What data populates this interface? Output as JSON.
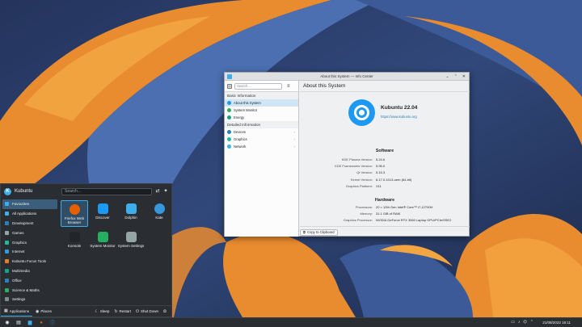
{
  "window": {
    "title": "About this System — Info Center",
    "search_placeholder": "Search...",
    "groups": [
      {
        "label": "Basic Information",
        "items": [
          {
            "label": "About this System",
            "selected": true,
            "color": "#1d99f3"
          },
          {
            "label": "System Monitor",
            "selected": false,
            "color": "#27ae60"
          },
          {
            "label": "Energy",
            "selected": false,
            "color": "#16a085"
          }
        ]
      },
      {
        "label": "Detailed Information",
        "items": [
          {
            "label": "Devices",
            "selected": false,
            "color": "#2980b9"
          },
          {
            "label": "Graphics",
            "selected": false,
            "color": "#1abc9c"
          },
          {
            "label": "Network",
            "selected": false,
            "color": "#3daee9"
          }
        ]
      }
    ],
    "main_title": "About this System",
    "os_name": "Kubuntu 22.04",
    "os_url": "https://www.kubuntu.org",
    "software_heading": "Software",
    "software": [
      {
        "k": "KDE Plasma Version:",
        "v": "5.24.6"
      },
      {
        "k": "KDE Frameworks Version:",
        "v": "5.95.0"
      },
      {
        "k": "Qt Version:",
        "v": "5.15.3"
      },
      {
        "k": "Kernel Version:",
        "v": "6.17.0-1013-oem (64-bit)"
      },
      {
        "k": "Graphics Platform:",
        "v": "X11"
      }
    ],
    "hardware_heading": "Hardware",
    "hardware": [
      {
        "k": "Processors:",
        "v": "20 × 12th Gen Intel® Core™ i7-12700H"
      },
      {
        "k": "Memory:",
        "v": "31.1 GiB of RAM"
      },
      {
        "k": "Graphics Processor:",
        "v": "NVIDIA GeForce RTX 3060 Laptop GPU/PCIe/SSE2"
      }
    ],
    "copy_label": "Copy to Clipboard"
  },
  "launcher": {
    "user": "Kubuntu",
    "search_placeholder": "Search...",
    "categories": [
      {
        "label": "Favourites",
        "color": "#3daee9",
        "selected": true
      },
      {
        "label": "All Applications",
        "color": "#3daee9",
        "selected": false
      },
      {
        "label": "Development",
        "color": "#2980b9",
        "selected": false
      },
      {
        "label": "Games",
        "color": "#95a5a6",
        "selected": false
      },
      {
        "label": "Graphics",
        "color": "#1abc9c",
        "selected": false
      },
      {
        "label": "Internet",
        "color": "#3498db",
        "selected": false
      },
      {
        "label": "Kubuntu Focus Tools",
        "color": "#e67e22",
        "selected": false
      },
      {
        "label": "Multimedia",
        "color": "#16a085",
        "selected": false
      },
      {
        "label": "Office",
        "color": "#2980b9",
        "selected": false
      },
      {
        "label": "Science & Maths",
        "color": "#27ae60",
        "selected": false
      },
      {
        "label": "Settings",
        "color": "#7f8c8d",
        "selected": false
      }
    ],
    "apps": [
      {
        "label": "Firefox Web Browser",
        "color": "#e66000",
        "selected": true
      },
      {
        "label": "Discover",
        "color": "#1d99f3",
        "selected": false
      },
      {
        "label": "Dolphin",
        "color": "#3daee9",
        "selected": false
      },
      {
        "label": "Kate",
        "color": "#3498db",
        "selected": false
      },
      {
        "label": "Konsole",
        "color": "#232629",
        "selected": false
      },
      {
        "label": "System Monitor",
        "color": "#27ae60",
        "selected": false
      },
      {
        "label": "System Settings",
        "color": "#95a5a6",
        "selected": false
      }
    ],
    "footer": {
      "applications": "Applications",
      "places": "Places",
      "sleep": "Sleep",
      "restart": "Restart",
      "shutdown": "Shut Down"
    }
  },
  "panel": {
    "clock": "21/08/2022  16:11"
  }
}
